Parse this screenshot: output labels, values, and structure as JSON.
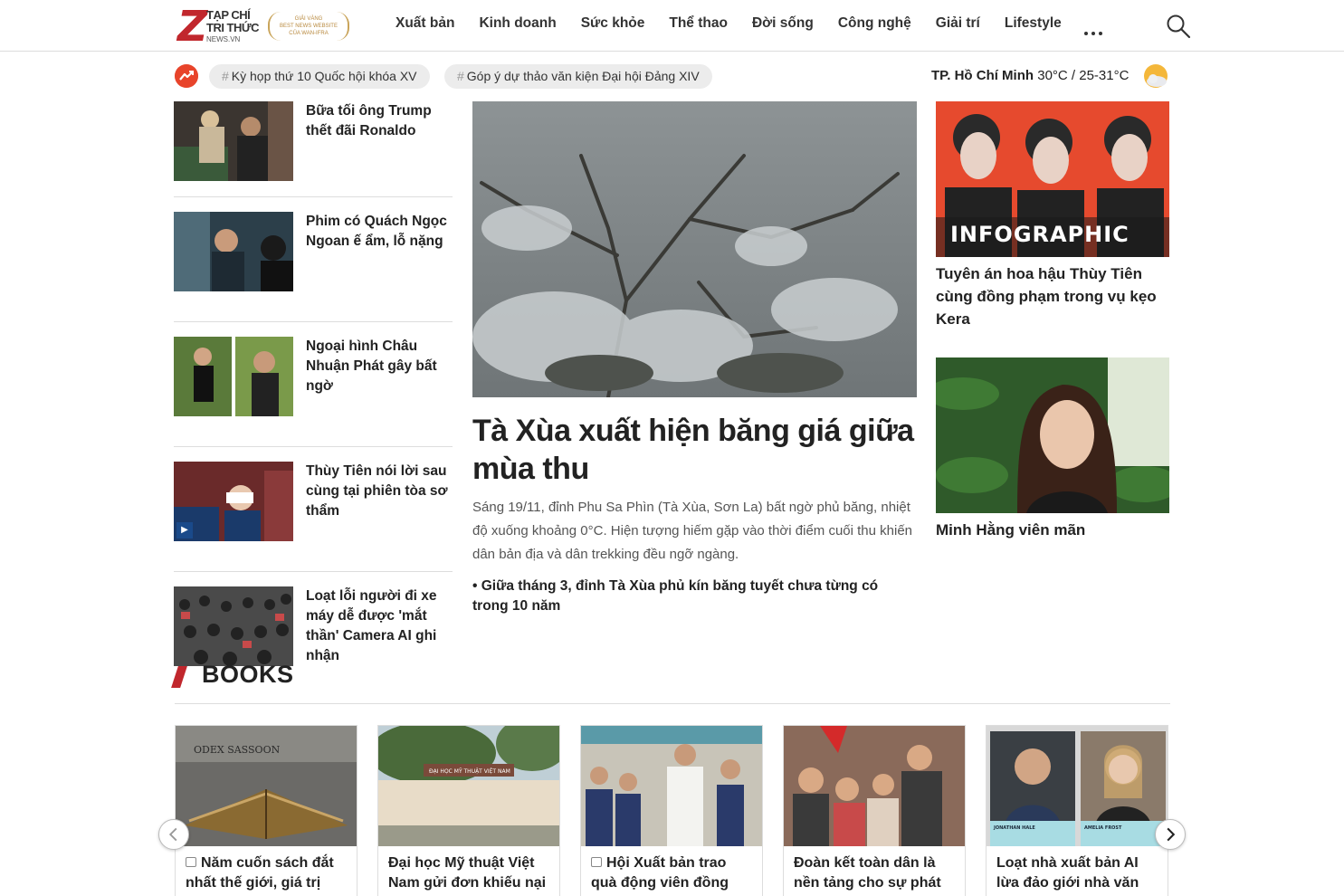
{
  "logo": {
    "line1": "TẠP CHÍ",
    "line2": "TRI THỨC",
    "line3": "NEWS.VN",
    "award": [
      "GIẢI VÀNG",
      "BEST NEWS WEBSITE",
      "CỦA WAN-IFRA"
    ]
  },
  "nav": [
    "Xuất bản",
    "Kinh doanh",
    "Sức khỏe",
    "Thể thao",
    "Đời sống",
    "Công nghệ",
    "Giải trí",
    "Lifestyle"
  ],
  "tags": [
    "Kỳ họp thứ 10 Quốc hội khóa XV",
    "Góp ý dự thảo văn kiện Đại hội Đảng XIV"
  ],
  "tag_hash": "#",
  "weather": {
    "city": "TP. Hồ Chí Minh",
    "temp": "30°C / 25-31°C"
  },
  "left_articles": [
    {
      "title": "Bữa tối ông Trump thết đãi Ronaldo"
    },
    {
      "title": "Phim có Quách Ngọc Ngoan ế ẩm, lỗ nặng"
    },
    {
      "title": "Ngoại hình Châu Nhuận Phát gây bất ngờ"
    },
    {
      "title": "Thùy Tiên nói lời sau cùng tại phiên tòa sơ thẩm",
      "video": true
    },
    {
      "title": "Loạt lỗi người đi xe máy dễ được 'mắt thần' Camera AI ghi nhận"
    }
  ],
  "hero": {
    "title": "Tà Xùa xuất hiện băng giá giữa mùa thu",
    "description": "Sáng 19/11, đỉnh Phu Sa Phìn (Tà Xùa, Sơn La) bất ngờ phủ băng, nhiệt độ xuống khoảng 0°C. Hiện tượng hiếm gặp vào thời điểm cuối thu khiến dân bản địa và dân trekking đều ngỡ ngàng.",
    "related": "• Giữa tháng 3, đỉnh Tà Xùa phủ kín băng tuyết chưa từng có trong 10 năm"
  },
  "right_articles": [
    {
      "title": "Tuyên án hoa hậu Thùy Tiên cùng đồng phạm trong vụ kẹo Kera",
      "overlay": "INFOGRAPHIC"
    },
    {
      "title": "Minh Hằng viên mãn"
    }
  ],
  "books": {
    "heading": "BOOKS",
    "cards": [
      {
        "title": "Năm cuốn sách đắt nhất thế giới, giá trị",
        "photo": true
      },
      {
        "title": "Đại học Mỹ thuật Việt Nam gửi đơn khiếu nại",
        "photo": false
      },
      {
        "title": "Hội Xuất bản trao quà động viên đồng",
        "photo": true
      },
      {
        "title": "Đoàn kết toàn dân là nền tảng cho sự phát",
        "photo": false
      },
      {
        "title": "Loạt nhà xuất bản AI lừa đảo giới nhà văn",
        "photo": false
      }
    ],
    "sign_text": "ĐẠI HỌC MỸ THUẬT VIỆT NAM",
    "book_text": "ODEX SASSOON",
    "people": [
      {
        "name": "JONATHAN HALE"
      },
      {
        "name": "AMELIA FROST"
      }
    ]
  },
  "colors": {
    "brand": "#c1272d",
    "trend": "#e8442b"
  }
}
